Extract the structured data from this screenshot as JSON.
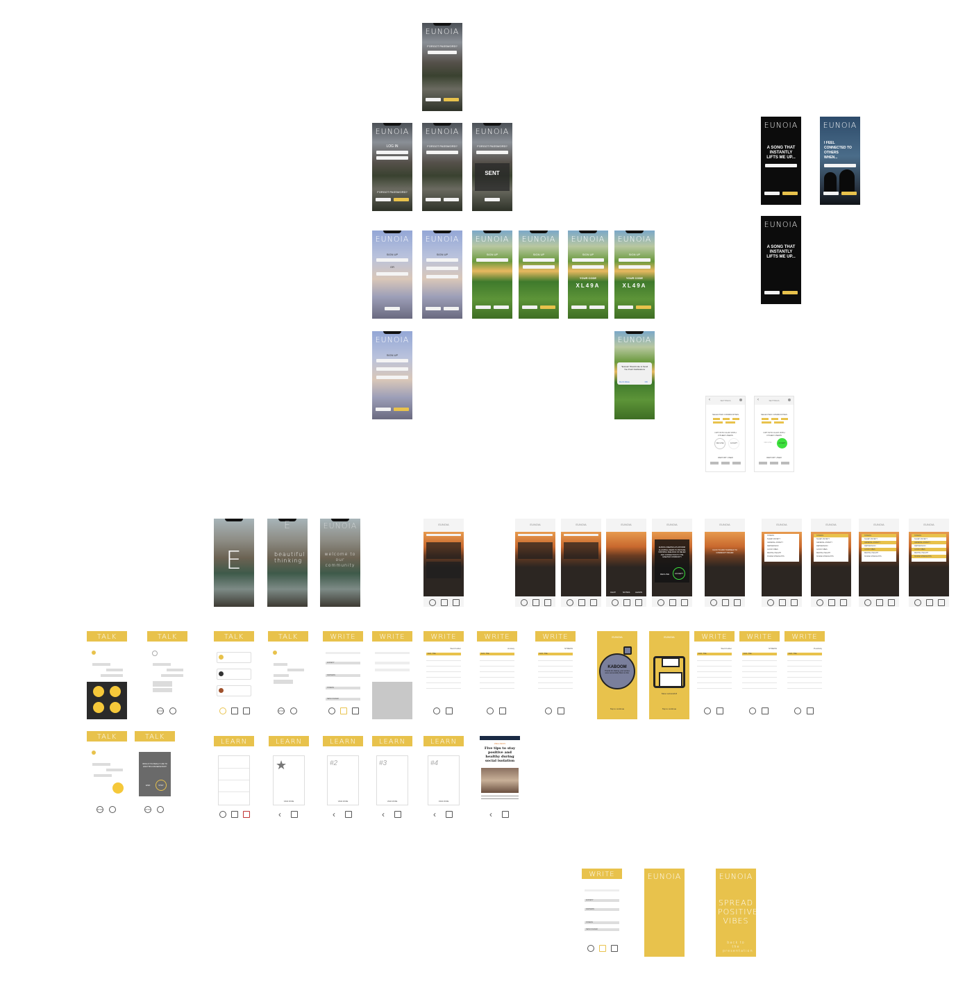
{
  "brand": "EUNOIA",
  "login": {
    "forgot_top": "FORGOT PASSWORD?",
    "log_in": "LOG IN",
    "forgot_password": "FORGOT PASSWORD?",
    "sent": "SENT"
  },
  "signup": {
    "title": "SIGN UP",
    "email": "EMAIL",
    "or": "OR",
    "phone": "PHONE NUMBER",
    "password": "PASSWORD",
    "confirm": "CONFIRM PASSWORD",
    "your_code": "YOUR CODE",
    "code": "XL49A",
    "notification": "\"Eunoia\" Would Like to Send You Push Notifications",
    "dont_allow": "Don't Allow",
    "allow": "OK"
  },
  "prompts": {
    "song": "A SONG THAT INSTANTLY LIFTS ME UP...",
    "connected": "I FEEL CONNECTED TO OTHERS WHEN..."
  },
  "settings": {
    "title": "SETTINGS",
    "communities": "SELECTED COMMUNITIES",
    "opt_in": "OPT INTO CHAT WITH OTHER USERS",
    "decline": "DECLINE",
    "accept": "ACCEPT",
    "report": "REPORT USER"
  },
  "intro": {
    "letter": "E",
    "beautiful": "beautiful thinking",
    "welcome": "welcome to our community"
  },
  "feed": {
    "accept_text": "EUNOIA CREATES A PLATFORM ALLOWING USERS TO PROVIDE INSPIRING FEELINGS OF RELIEF AND CONNECTION TO THE GREATER COMMUNITY",
    "decline": "DECLINE",
    "accept": "ACCEPT",
    "click_text": "CLICK TO ADD YOURSELF TO COMMUNITY BOARD",
    "tab_chat": "CHAT",
    "tab_notes": "NOTES",
    "tab_learn": "LEARN",
    "categories": [
      "STRESS",
      "SLEEP ANXIETY",
      "GENERAL ANXIETY",
      "DEPRESSION",
      "GOOD VIBES",
      "MENTAL HEALTH",
      "SHARE STRENGTHS"
    ]
  },
  "sections": {
    "talk": "TALK",
    "write": "WRITE",
    "learn": "LEARN"
  },
  "talk": {
    "stop_label": "STOP",
    "would_you_like": "WOULD YOU REALLY LIKE TO END THIS CONVERSATION?",
    "end": "END",
    "stay": "STAY"
  },
  "write": {
    "categories": [
      "ANXIETY",
      "SADNESS",
      "STRESS"
    ],
    "new_folder": "NEW FOLDER",
    "headers": [
      "Start Folder",
      "Anxiety",
      "STRESS",
      "Start Folder",
      "STRESS",
      "Positivity"
    ],
    "entry": "1/21 - Title",
    "kaboom": "KABOOM",
    "kaboom_text": "Thanks for sharing, your worries were successfully blown to bits.",
    "save_text": "Save successful!",
    "tap": "Tap to continue"
  },
  "learn": {
    "numbers": [
      "#2",
      "#3",
      "#4"
    ],
    "view_more": "VIEW MORE",
    "article_source": "USA TODAY",
    "article_tag": "WELLNESS",
    "article_title": "Five tips to stay positive and healthy during social isolation"
  },
  "final": {
    "spread": "SPREAD POSITIVE VIBES",
    "back": "back to the presentation"
  },
  "colors": {
    "accent": "#e8c24c",
    "dark": "#0c0c0c",
    "green_accept": "#3de03d"
  }
}
